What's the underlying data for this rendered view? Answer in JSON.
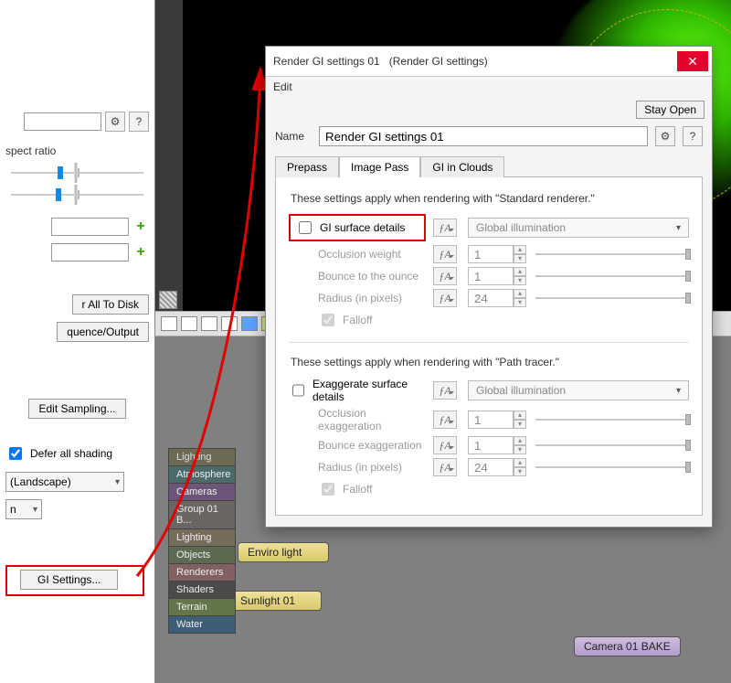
{
  "preview": {
    "present": true
  },
  "left": {
    "aspect_label": "spect ratio",
    "all_to_disk": "r All To Disk",
    "seq_output": "quence/Output",
    "edit_sampling": "Edit Sampling...",
    "defer_all": "Defer all shading",
    "landscape": "(Landscape)",
    "n_select": "n",
    "gi_settings": "GI Settings..."
  },
  "categories": {
    "head": "Lighting",
    "items": [
      "Atmosphere",
      "Cameras",
      "Group 01 B...",
      "Lighting",
      "Objects",
      "Renderers",
      "Shaders",
      "Terrain",
      "Water"
    ]
  },
  "nodes": {
    "enviro": "Enviro light",
    "sun": "Sunlight 01",
    "cam": "Camera 01 BAKE"
  },
  "dialog": {
    "title_a": "Render GI settings 01",
    "title_b": "(Render GI settings)",
    "edit_menu": "Edit",
    "stay_open": "Stay Open",
    "name_label": "Name",
    "name_value": "Render GI settings 01",
    "help": "?",
    "tabs": {
      "prepass": "Prepass",
      "image_pass": "Image Pass",
      "gi_clouds": "GI in Clouds"
    },
    "std_sentence": "These settings apply when rendering with \"Standard renderer.\"",
    "pt_sentence": "These settings apply when rendering with \"Path tracer.\"",
    "gi_surface_details": "GI surface details",
    "exaggerate": "Exaggerate surface details",
    "global_illum": "Global illumination",
    "occlusion_weight": "Occlusion weight",
    "bounce_ounce": "Bounce to the ounce",
    "radius_px": "Radius (in pixels)",
    "falloff": "Falloff",
    "occlusion_exag": "Occlusion exaggeration",
    "bounce_exag": "Bounce exaggeration",
    "vals": {
      "one": "1",
      "twentyfour": "24"
    }
  }
}
